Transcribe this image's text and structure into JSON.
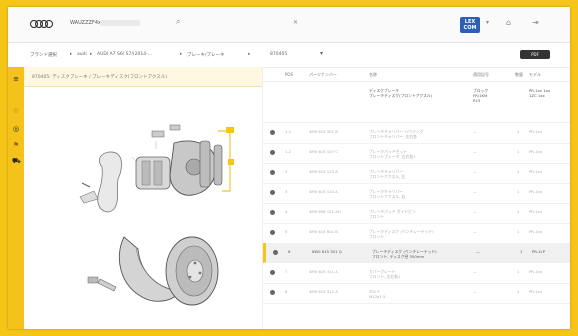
{
  "topbar": {
    "vin_prefix": "WAUZZZF4xxx",
    "brand_badge": "LEX\nCOM",
    "search_icon": "search-icon",
    "icons": [
      "cart-icon",
      "home-icon",
      "logout-icon"
    ]
  },
  "breadcrumb": {
    "items": [
      "ブランド選択",
      "audi",
      "AUDI A7 S6/ S7/(2014-...",
      "ブレーキ/ブレーキ",
      "ドライブ"
    ],
    "product_code": "870405",
    "right_badge": "PDF"
  },
  "left_panel": {
    "title": "870405: ディスクブレーキ / ブレーキディスク(フロントアクスル)"
  },
  "table": {
    "headers": [
      "POS",
      "パーツナンバー",
      "名称",
      "適用記号",
      "数量",
      "モデル"
    ],
    "first_row": {
      "name": "ディスクブレーキ\nブレーキディスク(フロントアクスル)",
      "code": "ブロック\nFR/1KM\nR15",
      "model": "PR-1xx 1xx\n1ZC 1xx"
    },
    "rows": [
      {
        "pos": "1-1",
        "part": "4M0 615 301 B",
        "name": "ブレーキキャリパー ハウジング\nフロントキャリパー, 左右各",
        "code": "—",
        "qty": "1",
        "model": "PR-1xx",
        "highlight": false
      },
      {
        "pos": "1-2",
        "part": "4M0 615 107 C",
        "name": "ブレーキパッドセット\nフロントブレーキ, 左右各1",
        "code": "—",
        "qty": "1",
        "model": "PR-1xx",
        "highlight": false
      },
      {
        "pos": "2",
        "part": "4M0 615 123 A",
        "name": "ブレーキキャリパー\nフロントアクスル, 左",
        "code": "—",
        "qty": "1",
        "model": "PR-1xx",
        "highlight": false
      },
      {
        "pos": "3",
        "part": "4M0 615 124 A",
        "name": "ブレーキキャリパー\nフロントアクスル, 右",
        "code": "—",
        "qty": "1",
        "model": "PR-1xx",
        "highlight": false
      },
      {
        "pos": "4",
        "part": "4M0 698 151 AH",
        "name": "ブレーキパッド ガイドピン\nフロント",
        "code": "—",
        "qty": "1",
        "model": "PR-1xx",
        "highlight": false
      },
      {
        "pos": "5",
        "part": "4M0 615 601 B",
        "name": "ブレーキディスク (ベンチレーテッド)\nフロント",
        "code": "—",
        "qty": "1",
        "model": "PR-1xx",
        "highlight": false
      },
      {
        "pos": "6",
        "part": "8W0 615 301 Q",
        "name": "ブレーキディスク (ベンチレーテッド)\nフロント, ディスク径 350mm",
        "code": "—",
        "qty": "1",
        "model": "PR-1LP",
        "highlight": true
      },
      {
        "pos": "7",
        "part": "4M0 615 311 A",
        "name": "カバープレート\nフロント, 左右各1",
        "code": "—",
        "qty": "1",
        "model": "PR-1xx",
        "highlight": false
      },
      {
        "pos": "8",
        "part": "4M0 615 312 A",
        "name": "ボルト\nM12x1.5",
        "code": "—",
        "qty": "1",
        "model": "PR-1xx",
        "highlight": false
      }
    ]
  },
  "colors": {
    "accent": "#f5c518",
    "highlight_row": "#f0f0f0"
  }
}
